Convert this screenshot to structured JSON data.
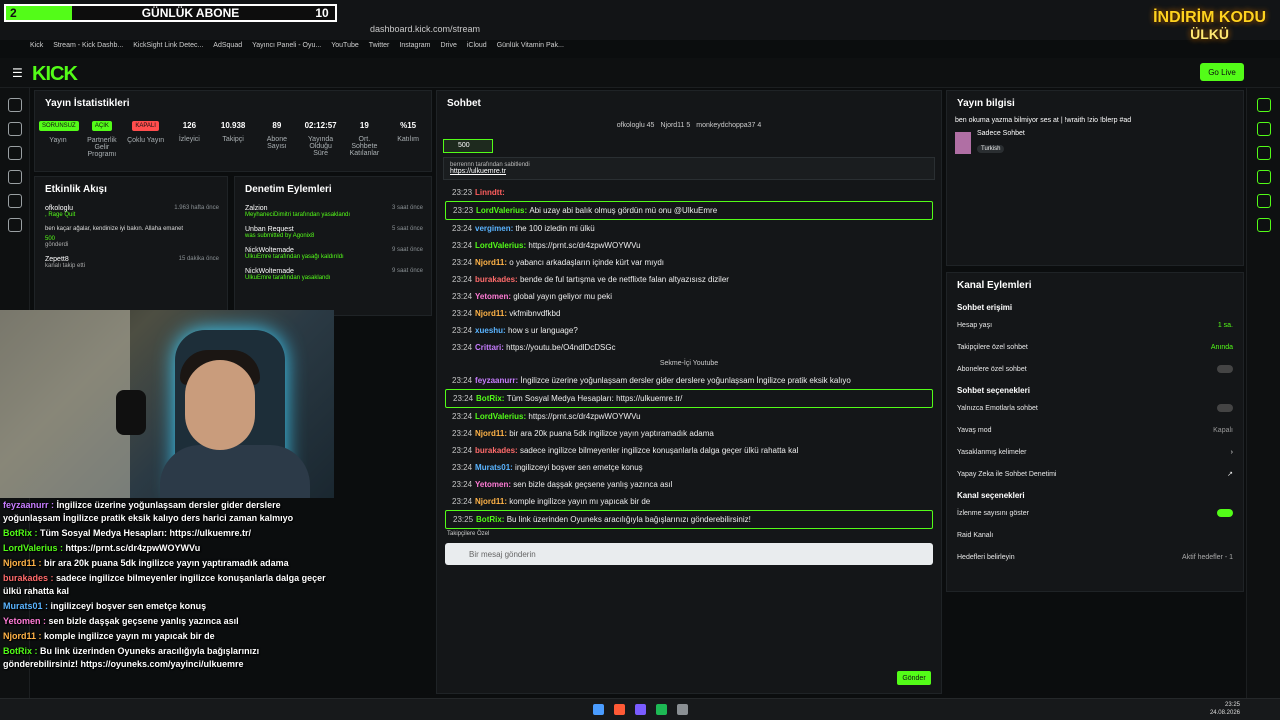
{
  "banner": {
    "num": "2",
    "label": "GÜNLÜK ABONE",
    "count": "10"
  },
  "promo": {
    "line1": "İNDİRİM KODU",
    "line2": "ÜLKÜ"
  },
  "browser": {
    "url": "dashboard.kick.com/stream",
    "bookmarks": [
      "Kick",
      "Stream - Kick Dashb...",
      "KickSight Link Detec...",
      "AdSquad",
      "Yayıncı Paneli - Oyu...",
      "YouTube",
      "Twitter",
      "Instagram",
      "Drive",
      "iCloud",
      "Günlük Vitamin Pak..."
    ]
  },
  "nav": {
    "logo": "KICK",
    "go_live": "Go Live"
  },
  "stats": {
    "title": "Yayın İstatistikleri",
    "items": [
      {
        "badge": "SORUNSUZ",
        "label": "Yayın",
        "color": "#53fc18"
      },
      {
        "badge": "AÇIK",
        "label": "Partnerlik Gelir Programı",
        "color": "#53fc18"
      },
      {
        "badge": "KAPALI",
        "label": "Çoklu Yayın",
        "color": "#ff4d4d"
      },
      {
        "value": "126",
        "label": "İzleyici"
      },
      {
        "value": "10.938",
        "label": "Takipçi"
      },
      {
        "value": "89",
        "label": "Abone Sayısı"
      },
      {
        "value": "02:12:57",
        "label": "Yayında Olduğu Süre"
      },
      {
        "value": "19",
        "label": "Ort. Sohbete Katılanlar"
      },
      {
        "value": "%15",
        "label": "Katılım"
      }
    ]
  },
  "activity": {
    "title": "Etkinlik Akışı",
    "items": [
      {
        "name": "ofkologlu",
        "sub": ", Rage Quit",
        "time": "1.963 hafta önce",
        "text": "ben kaçar ağalar, kendinize iyi bakın. Allaha emanet",
        "amount": "500",
        "note": "gönderdi"
      },
      {
        "name": "Zepett8",
        "sub": "kanalı takip etti",
        "time": "15 dakika önce"
      }
    ]
  },
  "moderation": {
    "title": "Denetim Eylemleri",
    "items": [
      {
        "name": "Zalzion",
        "sub": "MeyhaneciDimitri tarafından yasaklandı",
        "time": "3 saat önce"
      },
      {
        "name": "Unban Request",
        "sub": "was submitted by Agonix8",
        "time": "5 saat önce"
      },
      {
        "name": "NickWoltemade",
        "sub": "UlkuEmre tarafından yasağı kaldırıldı",
        "time": "9 saat önce"
      },
      {
        "name": "NickWoltemade",
        "sub": "UlkuEmre tarafından yasaklandı",
        "time": "9 saat önce"
      }
    ]
  },
  "overlay": [
    {
      "user": "feyzaanurr",
      "color": "#c77dff",
      "text": "İngilizce üzerine yoğunlaşsam dersler gider derslere yoğunlaşsam İngilizce pratik eksik kalıyo ders harici zaman kalmıyo"
    },
    {
      "user": "BotRix",
      "color": "#53fc18",
      "text": "Tüm Sosyal Medya Hesapları: https://ulkuemre.tr/"
    },
    {
      "user": "LordValerius",
      "color": "#53fc18",
      "text": "https://prnt.sc/dr4zpwWOYWVu"
    },
    {
      "user": "Njord11",
      "color": "#ffb347",
      "text": "bir ara 20k puana 5dk ingilizce yayın yaptıramadık adama"
    },
    {
      "user": "burakades",
      "color": "#ff6b6b",
      "text": "sadece ingilizce bilmeyenler ingilizce konuşanlarla dalga geçer ülkü rahatta kal"
    },
    {
      "user": "Murats01",
      "color": "#5ab4ff",
      "text": "ingilizceyi boşver sen emetçe konuş"
    },
    {
      "user": "Yetomen",
      "color": "#ff7bd5",
      "text": "sen bizle daşşak geçsene yanlış yazınca asıl"
    },
    {
      "user": "Njord11",
      "color": "#ffb347",
      "text": "komple ingilizce yayın mı yapıcak bir de"
    },
    {
      "user": "BotRix",
      "color": "#53fc18",
      "text": "Bu link üzerinden Oyuneks aracılığıyla bağışlarınızı gönderebilirsiniz! https://oyuneks.com/yayinci/ulkuemre"
    }
  ],
  "chat": {
    "title": "Sohbet",
    "top_users": [
      "ofkologlu 45",
      "Njord11 5",
      "monkeydchoppa37 4"
    ],
    "gift": "500",
    "pinned_by": "berrennn tarafından sabitlendi",
    "pinned_link": "https://ulkuemre.tr",
    "messages": [
      {
        "time": "23:23",
        "user": "Linndtt",
        "color": "#ff5e5e",
        "text": ""
      },
      {
        "time": "23:23",
        "user": "LordValerius",
        "color": "#53fc18",
        "text": "Abi uzay abi balık olmuş gördün mü onu @UlkuEmre",
        "hl": true
      },
      {
        "time": "23:24",
        "user": "vergimen",
        "color": "#5ab4ff",
        "text": "the 100 izledin mi ülkü"
      },
      {
        "time": "23:24",
        "user": "LordValerius",
        "color": "#53fc18",
        "text": "https://prnt.sc/dr4zpwWOYWVu"
      },
      {
        "time": "23:24",
        "user": "Njord11",
        "color": "#ffb347",
        "text": "o yabancı arkadaşların içinde kürt var mıydı"
      },
      {
        "time": "23:24",
        "user": "burakades",
        "color": "#ff6b6b",
        "text": "bende de ful tartışma ve de netflixte falan altyazısısz diziler"
      },
      {
        "time": "23:24",
        "user": "Yetomen",
        "color": "#ff7bd5",
        "text": "global yayın geliyor mu peki"
      },
      {
        "time": "23:24",
        "user": "Njord11",
        "color": "#ffb347",
        "text": "vkfmibnvdfkbd"
      },
      {
        "time": "23:24",
        "user": "xueshu",
        "color": "#5ab4ff",
        "text": "how s ur language?"
      },
      {
        "time": "23:24",
        "user": "Crittari",
        "color": "#c77dff",
        "text": "https://youtu.be/O4ndlDcDSGc"
      },
      {
        "sys": "Sekme-İçi Youtube"
      },
      {
        "time": "23:24",
        "user": "feyzaanurr",
        "color": "#c77dff",
        "text": "İngilizce üzerine yoğunlaşsam dersler gider derslere yoğunlaşsam İngilizce pratik eksik kalıyo"
      },
      {
        "time": "23:24",
        "user": "BotRix",
        "color": "#53fc18",
        "text": "Tüm Sosyal Medya Hesapları: https://ulkuemre.tr/",
        "hl": true
      },
      {
        "time": "23:24",
        "user": "LordValerius",
        "color": "#53fc18",
        "text": "https://prnt.sc/dr4zpwWOYWVu"
      },
      {
        "time": "23:24",
        "user": "Njord11",
        "color": "#ffb347",
        "text": "bir ara 20k puana 5dk ingilizce yayın yaptıramadık adama"
      },
      {
        "time": "23:24",
        "user": "burakades",
        "color": "#ff6b6b",
        "text": "sadece ingilizce bilmeyenler ingilizce konuşanlarla dalga geçer ülkü rahatta kal"
      },
      {
        "time": "23:24",
        "user": "Murats01",
        "color": "#5ab4ff",
        "text": "ingilizceyi boşver sen emetçe konuş"
      },
      {
        "time": "23:24",
        "user": "Yetomen",
        "color": "#ff7bd5",
        "text": "sen bizle daşşak geçsene yanlış yazınca asıl"
      },
      {
        "time": "23:24",
        "user": "Njord11",
        "color": "#ffb347",
        "text": "komple ingilizce yayın mı yapıcak bir de"
      },
      {
        "time": "23:25",
        "user": "BotRix",
        "color": "#53fc18",
        "text": "Bu link üzerinden Oyuneks aracılığıyla bağışlarınızı gönderebilirsiniz!",
        "hl": true
      }
    ],
    "placeholder": "Bir mesaj gönderin",
    "send": "Gönder",
    "follower_label": "Takipçilere Özel"
  },
  "info": {
    "title": "Yayın bilgisi",
    "stream_title": "ben okuma yazma bilmiyor ses at | !wraith !zio !blerp #ad",
    "category": "Sadece Sohbet",
    "tag": "Turkish"
  },
  "actions": {
    "title": "Kanal Eylemleri",
    "s1": "Sohbet erişimi",
    "age": "Hesap yaşı",
    "age_v": "1 sa.",
    "followers": "Takipçilere özel sohbet",
    "followers_v": "Anında",
    "subs": "Abonelere özel sohbet",
    "s2": "Sohbet seçenekleri",
    "emotes": "Yalnızca Emotlarla sohbet",
    "slow": "Yavaş mod",
    "slow_v": "Kapalı",
    "banned": "Yasaklanmış kelimeler",
    "ai": "Yapay Zeka ile Sohbet Denetimi",
    "s3": "Kanal seçenekleri",
    "viewers": "İzlenme sayısını göster",
    "raid": "Raid Kanalı",
    "goals": "Hedefleri belirleyin",
    "goals_v": "Aktif hedefler - 1"
  },
  "clock": {
    "time": "23:25",
    "date": "24.08.2026"
  }
}
